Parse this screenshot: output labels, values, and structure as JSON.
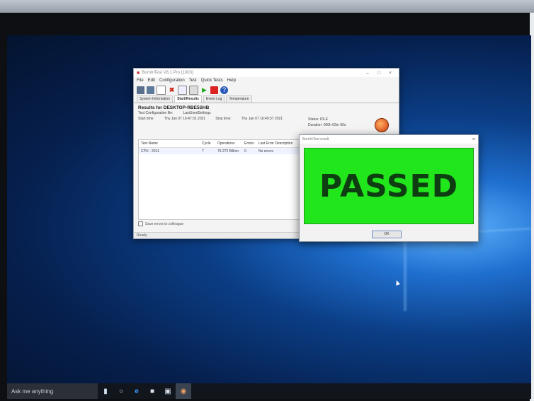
{
  "app": {
    "title": "BurnInTest V8.1 Pro (1003)",
    "menu": [
      "File",
      "Edit",
      "Configuration",
      "Test",
      "Quick Tests",
      "Help"
    ],
    "tabs": [
      "System Information",
      "Start/Results",
      "Event Log",
      "Temperature"
    ],
    "active_tab": "Start/Results",
    "results_header": "Results for DESKTOP-RBE5SHB",
    "test_config_label": "Test Configuration file:",
    "test_config_value": "LastUsedSettings",
    "start_time_label": "Start time:",
    "start_time_value": "Thu Jan 07 16:47:31 2021",
    "stop_time_label": "Stop time:",
    "stop_time_value": "Thu Jan 07 16:49:37 2021",
    "status_label": "Status:",
    "status_value": "IDLE",
    "duration_label": "Duration:",
    "duration_value": "000h 02m 06s",
    "grid_headers": [
      "Test Name",
      "Cycle",
      "Operations",
      "Errors",
      "Last Error Description"
    ],
    "grid_rows": [
      {
        "name": "CPU - 2011",
        "cycle": "7",
        "operations": "76.272 Billion",
        "errors": "0",
        "last_error": "No errors"
      }
    ],
    "checkbox_label": "Save errors to colleague",
    "statusbar": "Ready"
  },
  "dialog": {
    "title": "BurnInTest result",
    "result_text": "PASSED",
    "ok_label": "OK",
    "result_color": "#22e61c"
  },
  "taskbar": {
    "search_placeholder": "Ask me anything",
    "icons": [
      "mic-icon",
      "task-view-icon",
      "edge-icon",
      "explorer-icon",
      "store-icon",
      "burnintest-icon"
    ]
  }
}
